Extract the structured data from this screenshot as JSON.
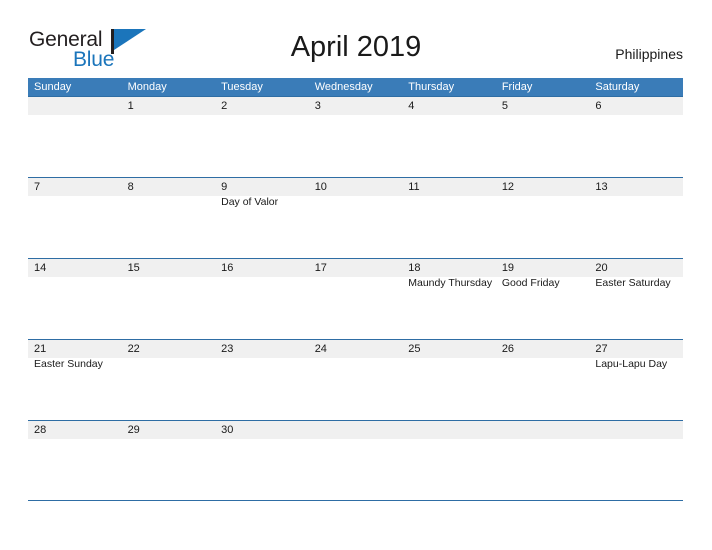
{
  "brand": {
    "name_part1": "General",
    "name_part2": "Blue",
    "color_dark": "#231f20",
    "color_blue": "#1b75bb"
  },
  "header": {
    "title": "April 2019",
    "country": "Philippines"
  },
  "calendar": {
    "header_bg": "#3a7cb8",
    "band_bg": "#f0f0f0",
    "rule_color": "#2e6da4",
    "day_names": [
      "Sunday",
      "Monday",
      "Tuesday",
      "Wednesday",
      "Thursday",
      "Friday",
      "Saturday"
    ],
    "weeks": [
      [
        {
          "date": "",
          "event": ""
        },
        {
          "date": "1",
          "event": ""
        },
        {
          "date": "2",
          "event": ""
        },
        {
          "date": "3",
          "event": ""
        },
        {
          "date": "4",
          "event": ""
        },
        {
          "date": "5",
          "event": ""
        },
        {
          "date": "6",
          "event": ""
        }
      ],
      [
        {
          "date": "7",
          "event": ""
        },
        {
          "date": "8",
          "event": ""
        },
        {
          "date": "9",
          "event": "Day of Valor"
        },
        {
          "date": "10",
          "event": ""
        },
        {
          "date": "11",
          "event": ""
        },
        {
          "date": "12",
          "event": ""
        },
        {
          "date": "13",
          "event": ""
        }
      ],
      [
        {
          "date": "14",
          "event": ""
        },
        {
          "date": "15",
          "event": ""
        },
        {
          "date": "16",
          "event": ""
        },
        {
          "date": "17",
          "event": ""
        },
        {
          "date": "18",
          "event": "Maundy Thursday"
        },
        {
          "date": "19",
          "event": "Good Friday"
        },
        {
          "date": "20",
          "event": "Easter Saturday"
        }
      ],
      [
        {
          "date": "21",
          "event": "Easter Sunday"
        },
        {
          "date": "22",
          "event": ""
        },
        {
          "date": "23",
          "event": ""
        },
        {
          "date": "24",
          "event": ""
        },
        {
          "date": "25",
          "event": ""
        },
        {
          "date": "26",
          "event": ""
        },
        {
          "date": "27",
          "event": "Lapu-Lapu Day"
        }
      ],
      [
        {
          "date": "28",
          "event": ""
        },
        {
          "date": "29",
          "event": ""
        },
        {
          "date": "30",
          "event": ""
        },
        {
          "date": "",
          "event": ""
        },
        {
          "date": "",
          "event": ""
        },
        {
          "date": "",
          "event": ""
        },
        {
          "date": "",
          "event": ""
        }
      ]
    ]
  }
}
